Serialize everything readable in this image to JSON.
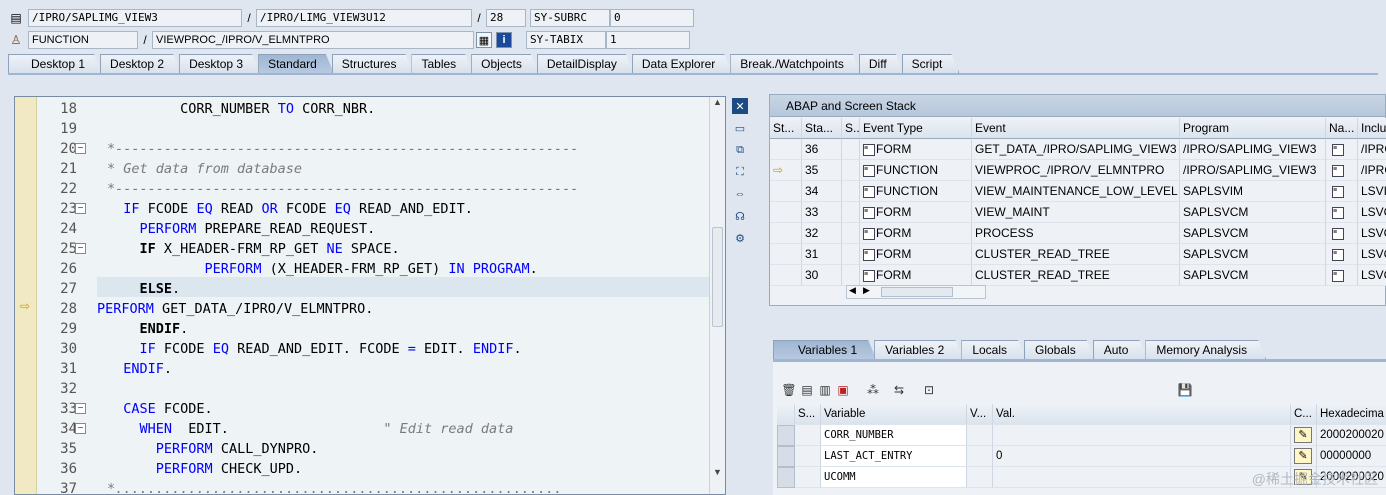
{
  "header": {
    "row1": {
      "program": "/IPRO/SAPLIMG_VIEW3",
      "include": "/IPRO/LIMG_VIEW3U12",
      "line": "28",
      "sysvar": "SY-SUBRC",
      "sysval": "0"
    },
    "row2": {
      "type": "FUNCTION",
      "name": "VIEWPROC_/IPRO/V_ELMNTPRO",
      "sysvar": "SY-TABIX",
      "sysval": "1"
    },
    "sep": "/"
  },
  "tabs": [
    "Desktop 1",
    "Desktop 2",
    "Desktop 3",
    "Standard",
    "Structures",
    "Tables",
    "Objects",
    "DetailDisplay",
    "Data Explorer",
    "Break./Watchpoints",
    "Diff",
    "Script"
  ],
  "active_tab": "Standard",
  "editor": {
    "lines": [
      {
        "n": "18",
        "code": [
          {
            "t": "         CORR_NUMBER ",
            "c": ""
          },
          {
            "t": "TO",
            "c": "kw"
          },
          {
            "t": " CORR_NBR.",
            "c": ""
          }
        ]
      },
      {
        "n": "19",
        "code": []
      },
      {
        "n": "20",
        "code": [
          {
            "t": "*---------------------------------------------------------",
            "c": "cm"
          }
        ]
      },
      {
        "n": "21",
        "code": [
          {
            "t": "* Get data from database",
            "c": "cm"
          }
        ]
      },
      {
        "n": "22",
        "code": [
          {
            "t": "*---------------------------------------------------------",
            "c": "cm"
          }
        ]
      },
      {
        "n": "23",
        "code": [
          {
            "t": "  ",
            "c": ""
          },
          {
            "t": "IF",
            "c": "kw"
          },
          {
            "t": " FCODE ",
            "c": ""
          },
          {
            "t": "EQ",
            "c": "kw"
          },
          {
            "t": " READ ",
            "c": ""
          },
          {
            "t": "OR",
            "c": "kw"
          },
          {
            "t": " FCODE ",
            "c": ""
          },
          {
            "t": "EQ",
            "c": "kw"
          },
          {
            "t": " READ_AND_EDIT.",
            "c": ""
          }
        ]
      },
      {
        "n": "24",
        "code": [
          {
            "t": "    ",
            "c": ""
          },
          {
            "t": "PERFORM",
            "c": "kw"
          },
          {
            "t": " PREPARE_READ_REQUEST.",
            "c": ""
          }
        ]
      },
      {
        "n": "25",
        "code": [
          {
            "t": "    ",
            "c": ""
          },
          {
            "t": "IF",
            "c": "kwb"
          },
          {
            "t": " X_HEADER-FRM_RP_GET ",
            "c": ""
          },
          {
            "t": "NE",
            "c": "kw"
          },
          {
            "t": " SPACE.",
            "c": ""
          }
        ]
      },
      {
        "n": "26",
        "code": [
          {
            "t": "            ",
            "c": ""
          },
          {
            "t": "PERFORM",
            "c": "kw"
          },
          {
            "t": " (X_HEADER-FRM_RP_GET) ",
            "c": ""
          },
          {
            "t": "IN PROGRAM",
            "c": "kw"
          },
          {
            "t": ".",
            "c": ""
          }
        ]
      },
      {
        "n": "27",
        "code": [
          {
            "t": "    ",
            "c": ""
          },
          {
            "t": "ELSE",
            "c": "kwb"
          },
          {
            "t": ".",
            "c": ""
          }
        ]
      },
      {
        "n": "28",
        "code": [
          {
            "t": "PERFORM",
            "c": "kw"
          },
          {
            "t": " GET_DATA_/IPRO/V_ELMNTPRO.",
            "c": ""
          }
        ]
      },
      {
        "n": "29",
        "code": [
          {
            "t": "    ",
            "c": ""
          },
          {
            "t": "ENDIF",
            "c": "kwb"
          },
          {
            "t": ".",
            "c": ""
          }
        ]
      },
      {
        "n": "30",
        "code": [
          {
            "t": "    ",
            "c": ""
          },
          {
            "t": "IF",
            "c": "kw"
          },
          {
            "t": " FCODE ",
            "c": ""
          },
          {
            "t": "EQ",
            "c": "kw"
          },
          {
            "t": " READ_AND_EDIT. FCODE ",
            "c": ""
          },
          {
            "t": "=",
            "c": "kw"
          },
          {
            "t": " EDIT. ",
            "c": ""
          },
          {
            "t": "ENDIF",
            "c": "kw"
          },
          {
            "t": ".",
            "c": ""
          }
        ]
      },
      {
        "n": "31",
        "code": [
          {
            "t": "  ",
            "c": ""
          },
          {
            "t": "ENDIF",
            "c": "kw"
          },
          {
            "t": ".",
            "c": ""
          }
        ]
      },
      {
        "n": "32",
        "code": []
      },
      {
        "n": "33",
        "code": [
          {
            "t": "  ",
            "c": ""
          },
          {
            "t": "CASE",
            "c": "kw"
          },
          {
            "t": " FCODE.",
            "c": ""
          }
        ]
      },
      {
        "n": "34",
        "code": [
          {
            "t": "    ",
            "c": ""
          },
          {
            "t": "WHEN",
            "c": "kw"
          },
          {
            "t": "  EDIT.",
            "c": ""
          },
          {
            "t": "                   \" Edit read data",
            "c": "cm"
          }
        ]
      },
      {
        "n": "35",
        "code": [
          {
            "t": "      ",
            "c": ""
          },
          {
            "t": "PERFORM",
            "c": "kw"
          },
          {
            "t": " CALL_DYNPRO.",
            "c": ""
          }
        ]
      },
      {
        "n": "36",
        "code": [
          {
            "t": "      ",
            "c": ""
          },
          {
            "t": "PERFORM",
            "c": "kw"
          },
          {
            "t": " CHECK_UPD.",
            "c": ""
          }
        ]
      },
      {
        "n": "37",
        "code": [
          {
            "t": "*.......................................................",
            "c": "cm"
          }
        ]
      }
    ]
  },
  "stack": {
    "title": "ABAP and Screen Stack",
    "columns": [
      "St...",
      "Sta...",
      "S...",
      "Event Type",
      "Event",
      "Program",
      "Na...",
      "Inclu"
    ],
    "rows": [
      {
        "level": "36",
        "type": "FORM",
        "event": "GET_DATA_/IPRO/SAPLIMG_VIEW3",
        "program": "/IPRO/SAPLIMG_VIEW3",
        "incl": "/IPRO",
        "current": false
      },
      {
        "level": "35",
        "type": "FUNCTION",
        "event": "VIEWPROC_/IPRO/V_ELMNTPRO",
        "program": "/IPRO/SAPLIMG_VIEW3",
        "incl": "/IPRO",
        "current": true
      },
      {
        "level": "34",
        "type": "FUNCTION",
        "event": "VIEW_MAINTENANCE_LOW_LEVEL",
        "program": "SAPLSVIM",
        "incl": "LSVIM",
        "current": false
      },
      {
        "level": "33",
        "type": "FORM",
        "event": "VIEW_MAINT",
        "program": "SAPLSVCM",
        "incl": "LSVC",
        "current": false
      },
      {
        "level": "32",
        "type": "FORM",
        "event": "PROCESS",
        "program": "SAPLSVCM",
        "incl": "LSVC",
        "current": false
      },
      {
        "level": "31",
        "type": "FORM",
        "event": "CLUSTER_READ_TREE",
        "program": "SAPLSVCM",
        "incl": "LSVC",
        "current": false
      },
      {
        "level": "30",
        "type": "FORM",
        "event": "CLUSTER_READ_TREE",
        "program": "SAPLSVCM",
        "incl": "LSVC",
        "current": false
      }
    ]
  },
  "vars": {
    "tabs": [
      "Variables 1",
      "Variables 2",
      "Locals",
      "Globals",
      "Auto",
      "Memory Analysis"
    ],
    "active": "Variables 1",
    "columns": [
      "S...",
      "Variable",
      "V...",
      "Val.",
      "C...",
      "Hexadecima"
    ],
    "rows": [
      {
        "name": "CORR_NUMBER",
        "val": "",
        "hex": "2000200020"
      },
      {
        "name": "LAST_ACT_ENTRY",
        "val": "0",
        "hex": "00000000"
      },
      {
        "name": "UCOMM",
        "val": "",
        "hex": "2000200020"
      }
    ]
  },
  "watermark": "@稀土掘金技术社区"
}
